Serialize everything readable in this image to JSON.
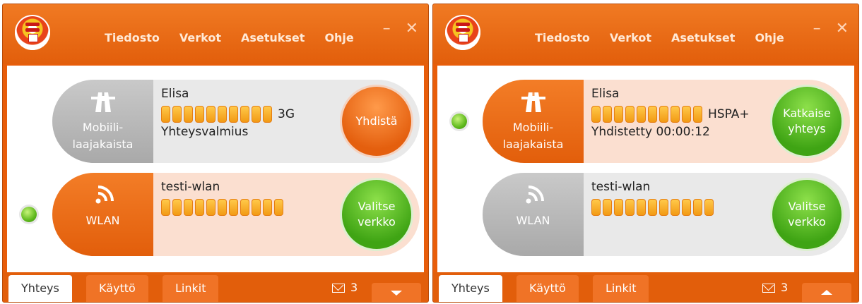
{
  "windows": [
    {
      "menu": [
        "Tiedosto",
        "Verkot",
        "Asetukset",
        "Ohje"
      ],
      "controls": {
        "minimize": "–",
        "close": "✕"
      },
      "connections": [
        {
          "type_label_1": "Mobiili-",
          "type_label_2": "laajakaista",
          "icon": "highway-icon",
          "name": "Elisa",
          "signal_bars": 10,
          "technology": "3G",
          "status": "Yhteysvalmius",
          "button": "Yhdistä",
          "button_color": "orange",
          "pill_color": "grey",
          "row_state": "idle",
          "active": false
        },
        {
          "type_label_1": "WLAN",
          "type_label_2": "",
          "icon": "wifi-icon",
          "name": "testi-wlan",
          "signal_bars": 11,
          "technology": "",
          "status": "",
          "button_line_1": "Valitse",
          "button_line_2": "verkko",
          "button_color": "green",
          "pill_color": "orange",
          "row_state": "active",
          "active": true
        }
      ],
      "tabs": [
        "Yhteys",
        "Käyttö",
        "Linkit"
      ],
      "selected_tab": "Yhteys",
      "messages": "3",
      "toggle_icon": "chevron-down-icon"
    },
    {
      "menu": [
        "Tiedosto",
        "Verkot",
        "Asetukset",
        "Ohje"
      ],
      "controls": {
        "minimize": "–",
        "close": "✕"
      },
      "connections": [
        {
          "type_label_1": "Mobiili-",
          "type_label_2": "laajakaista",
          "icon": "highway-icon",
          "name": "Elisa",
          "signal_bars": 10,
          "technology": "HSPA+",
          "status": "Yhdistetty 00:00:12",
          "button_line_1": "Katkaise",
          "button_line_2": "yhteys",
          "button_color": "green",
          "pill_color": "orange",
          "row_state": "active",
          "active": true
        },
        {
          "type_label_1": "WLAN",
          "type_label_2": "",
          "icon": "wifi-icon",
          "name": "testi-wlan",
          "signal_bars": 11,
          "technology": "",
          "status": "",
          "button_line_1": "Valitse",
          "button_line_2": "verkko",
          "button_color": "green",
          "pill_color": "grey",
          "row_state": "idle",
          "active": false
        }
      ],
      "tabs": [
        "Yhteys",
        "Käyttö",
        "Linkit"
      ],
      "selected_tab": "Yhteys",
      "messages": "3",
      "toggle_icon": "chevron-up-icon"
    }
  ],
  "colors": {
    "brand_orange": "#e85d0a",
    "active_green": "#4caf1a",
    "row_active": "#fbdfd0",
    "row_idle": "#e9e9e9"
  }
}
